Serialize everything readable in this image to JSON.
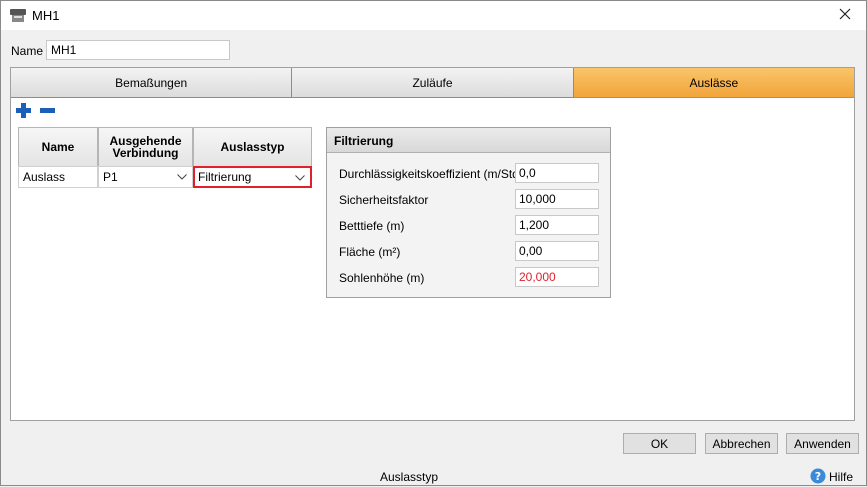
{
  "window": {
    "title": "MH1"
  },
  "name_field": {
    "label": "Name",
    "value": "MH1"
  },
  "tabs": [
    {
      "label": "Bemaßungen",
      "active": false
    },
    {
      "label": "Zuläufe",
      "active": false
    },
    {
      "label": "Auslässe",
      "active": true
    }
  ],
  "toolbar": {
    "add_icon": "plus-icon",
    "remove_icon": "minus-icon"
  },
  "grid": {
    "headers": {
      "name": "Name",
      "connection": "Ausgehende Verbindung",
      "type": "Auslasstyp"
    },
    "rows": [
      {
        "name": "Auslass",
        "connection": "P1",
        "type": "Filtrierung"
      }
    ]
  },
  "filter": {
    "title": "Filtrierung",
    "fields": [
      {
        "label": "Durchlässigkeitskoeffizient (m/Std.)",
        "value": "0,0"
      },
      {
        "label": "Sicherheitsfaktor",
        "value": "10,000"
      },
      {
        "label": "Betttiefe (m)",
        "value": "1,200"
      },
      {
        "label": "Fläche (m²)",
        "value": "0,00"
      },
      {
        "label": "Sohlenhöhe (m)",
        "value": "20,000"
      }
    ]
  },
  "buttons": {
    "ok": "OK",
    "cancel": "Abbrechen",
    "apply": "Anwenden"
  },
  "status": {
    "text": "Auslasstyp",
    "help": "Hilfe"
  },
  "colors": {
    "active_tab": "#f2a43a",
    "error_value": "#e0202a",
    "icon_blue": "#1d5fb8"
  }
}
